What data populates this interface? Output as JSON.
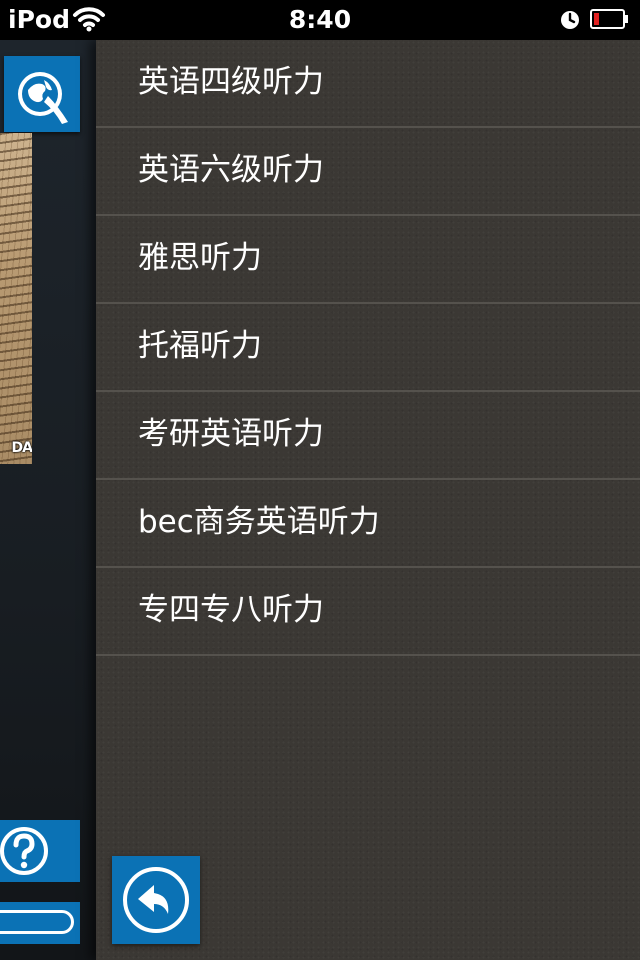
{
  "status_bar": {
    "carrier": "iPod",
    "time": "8:40",
    "icons": [
      "wifi-icon",
      "clock-icon",
      "battery-low-icon"
    ],
    "battery_color": "#e02020"
  },
  "left_panel": {
    "newspaper_label": "DA",
    "tile_color": "#0b72b5",
    "icons": [
      "app-logo-icon",
      "help-icon",
      "toggle-switch-icon"
    ]
  },
  "menu": {
    "items": [
      {
        "label": "英语四级听力"
      },
      {
        "label": "英语六级听力"
      },
      {
        "label": "雅思听力"
      },
      {
        "label": "托福听力"
      },
      {
        "label": "考研英语听力"
      },
      {
        "label": "bec商务英语听力"
      },
      {
        "label": "专四专八听力"
      }
    ],
    "back_icon": "back-arrow-icon"
  }
}
